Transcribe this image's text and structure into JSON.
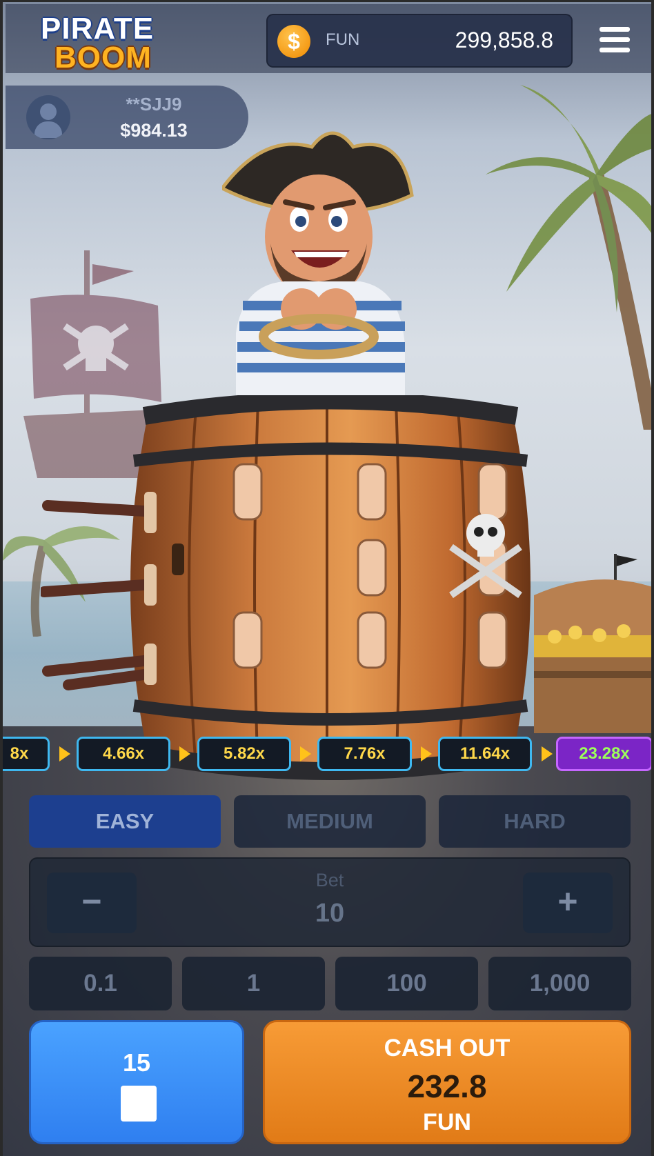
{
  "game": {
    "logo_line1": "PIRATE",
    "logo_line2": "BOOM"
  },
  "header": {
    "currency": "FUN",
    "balance": "299,858.8",
    "coin_symbol": "$"
  },
  "player": {
    "name": "**SJJ9",
    "amount": "$984.13"
  },
  "multipliers": [
    "8x",
    "4.66x",
    "5.82x",
    "7.76x",
    "11.64x",
    "23.28x"
  ],
  "highlighted_multiplier": "23.28x",
  "difficulty": {
    "options": [
      "EASY",
      "MEDIUM",
      "HARD"
    ],
    "selected": "EASY"
  },
  "bet": {
    "label": "Bet",
    "value": "10",
    "minus": "−",
    "plus": "+"
  },
  "quick_bets": [
    "0.1",
    "1",
    "100",
    "1,000"
  ],
  "auto": {
    "count": "15"
  },
  "cashout": {
    "label": "CASH OUT",
    "amount": "232.8",
    "currency": "FUN"
  },
  "colors": {
    "cashout": "#e88a24",
    "auto": "#3b8ff5",
    "multiplier_border": "#3fb8f0",
    "multiplier_text": "#ffd84a",
    "highlight_bg": "#7b25c6"
  }
}
